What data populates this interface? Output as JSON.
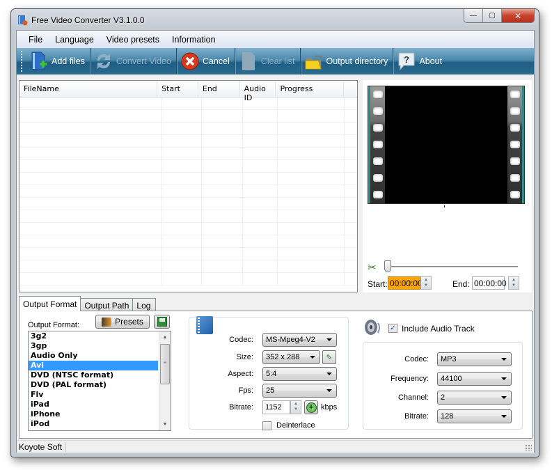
{
  "window": {
    "title": "Free Video Converter V3.1.0.0",
    "controls": {
      "minimize": "—",
      "maximize": "▢",
      "close": "✕"
    }
  },
  "menu": [
    "File",
    "Language",
    "Video presets",
    "Information"
  ],
  "toolbar": {
    "buttons": [
      {
        "label": "Add files",
        "icon": "add-files-icon",
        "enabled": true
      },
      {
        "label": "Convert Video",
        "icon": "convert-icon",
        "enabled": false
      },
      {
        "label": "Cancel",
        "icon": "cancel-icon",
        "enabled": true
      },
      {
        "label": "Clear list",
        "icon": "clear-list-icon",
        "enabled": false
      },
      {
        "label": "Output directory",
        "icon": "folder-icon",
        "enabled": true
      },
      {
        "label": "About",
        "icon": "help-icon",
        "enabled": true
      }
    ]
  },
  "file_grid": {
    "columns": [
      "FileName",
      "Start",
      "End",
      "Audio ID",
      "Progress"
    ],
    "rows": []
  },
  "preview": {
    "trim": {
      "start_label": "Start:",
      "start_value": "00:00:00",
      "end_label": "End:",
      "end_value": "00:00:00",
      "slider_position": 0
    }
  },
  "tabs": [
    "Output Format",
    "Output Path",
    "Log"
  ],
  "output_format": {
    "label": "Output Format:",
    "presets_label": "Presets",
    "formats": [
      "3g2",
      "3gp",
      "Audio Only",
      "Avi",
      "DVD (NTSC format)",
      "DVD (PAL format)",
      "Flv",
      "iPad",
      "iPhone",
      "iPod"
    ],
    "selected": "Avi"
  },
  "video": {
    "codec_label": "Codec:",
    "codec": "MS-Mpeg4-V2",
    "size_label": "Size:",
    "size": "352 x 288",
    "aspect_label": "Aspect:",
    "aspect": "5:4",
    "fps_label": "Fps:",
    "fps": "25",
    "bitrate_label": "Bitrate:",
    "bitrate": "1152",
    "bitrate_unit": "kbps",
    "deinterlace_label": "Deinterlace",
    "deinterlace": false
  },
  "audio": {
    "include_label": "Include Audio Track",
    "include": true,
    "codec_label": "Codec:",
    "codec": "MP3",
    "frequency_label": "Frequency:",
    "frequency": "44100",
    "channel_label": "Channel:",
    "channel": "2",
    "bitrate_label": "Bitrate:",
    "bitrate": "128"
  },
  "status": {
    "text": "Koyote Soft"
  },
  "colors": {
    "selection": "#3399ff",
    "start_highlight": "#ffa500",
    "toolbar": "#2a6b90"
  }
}
